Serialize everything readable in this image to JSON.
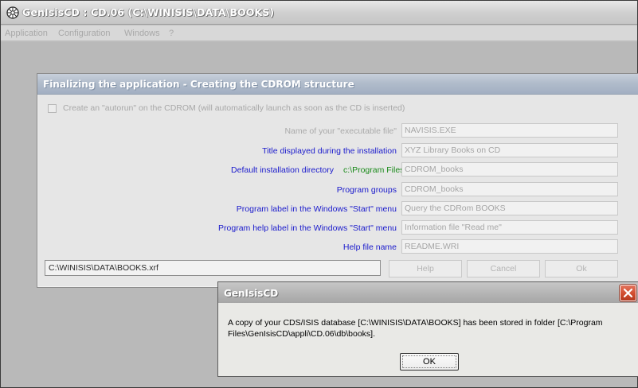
{
  "window": {
    "title": "GenIsisCD : CD.06 (C:\\WINISIS\\DATA\\BOOKS)"
  },
  "menu": {
    "items": [
      "Application",
      "Configuration",
      "Windows",
      "?"
    ]
  },
  "cd_dialog": {
    "title": "Finalizing the application - Creating the CDROM structure",
    "autorun_checked": false,
    "autorun_label": "Create an \"autorun\" on the CDROM (will automatically launch as soon as the CD is inserted)",
    "fields": [
      {
        "label": "Name of your \"executable file\"",
        "value": "NAVISIS.EXE"
      },
      {
        "label": "Title displayed during the installation",
        "value": "XYZ Library Books on CD"
      },
      {
        "label": "Default installation directory",
        "prefix": "c:\\Program Files\\",
        "value": "CDROM_books"
      },
      {
        "label": "Program groups",
        "value": "CDROM_books"
      },
      {
        "label": "Program label in the Windows \"Start\" menu",
        "value": "Query the CDRom BOOKS"
      },
      {
        "label": "Program help label in the Windows \"Start\" menu",
        "value": "Information file \"Read me\""
      },
      {
        "label": "Help file name",
        "value": "README.WRI"
      }
    ],
    "path": "C:\\WINISIS\\DATA\\BOOKS.xrf",
    "buttons": {
      "help": "Help",
      "cancel": "Cancel",
      "ok": "Ok"
    }
  },
  "message_box": {
    "title": "GenIsisCD",
    "text": "A copy of your CDS/ISIS database [C:\\WINISIS\\DATA\\BOOKS] has been stored in folder [C:\\Program Files\\GenIsisCD\\appli\\CD.06\\db\\books].",
    "ok_label": "OK"
  }
}
